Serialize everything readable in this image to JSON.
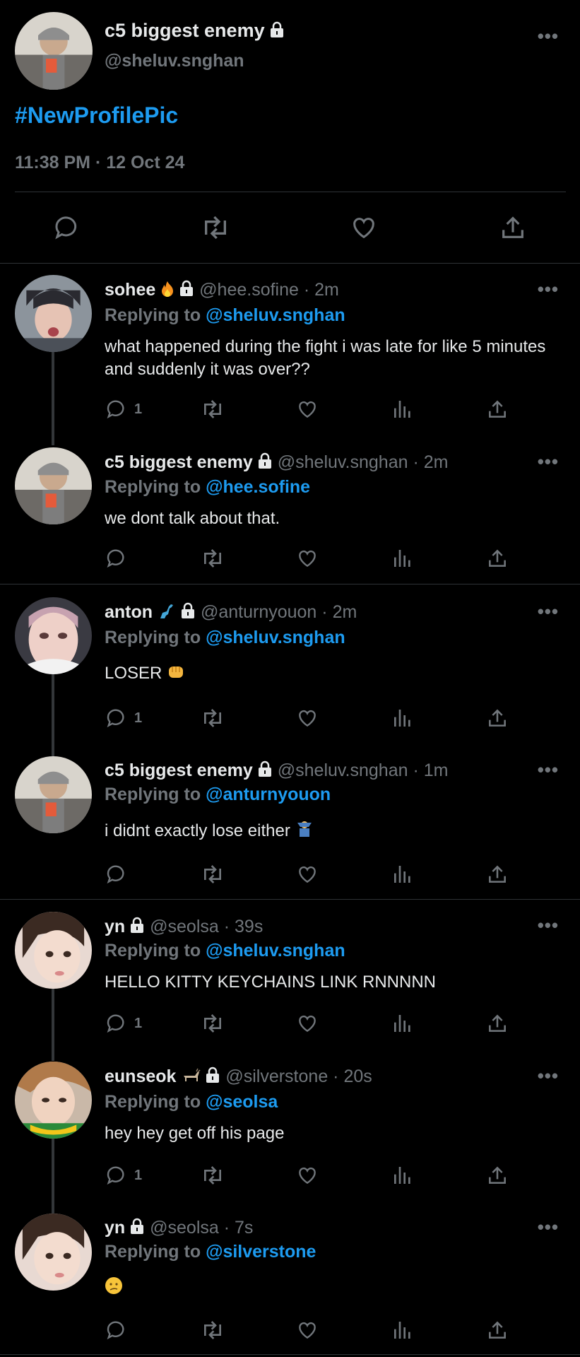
{
  "main_tweet": {
    "name": "c5 biggest enemy",
    "handle": "@sheluv.snghan",
    "text": "#NewProfilePic",
    "timestamp": "11:38 PM · 12 Oct 24",
    "more": "•••"
  },
  "replies": [
    {
      "name": "sohee",
      "emoji": "fire",
      "handle": "@hee.sofine",
      "time": "· 2m",
      "replying_label": "Replying to",
      "replying_to": "@sheluv.snghan",
      "text": "what happened during the fight i was late for like 5 minutes and suddenly it was over??",
      "reply_count": "1"
    },
    {
      "name": "c5 biggest enemy",
      "handle": "@sheluv.snghan",
      "time": "· 2m",
      "replying_label": "Replying to",
      "replying_to": "@hee.sofine",
      "text": "we dont talk about that.",
      "reply_count": ""
    },
    {
      "name": "anton",
      "emoji": "dinosaur",
      "handle": "@anturnyouon",
      "time": "· 2m",
      "replying_label": "Replying to",
      "replying_to": "@sheluv.snghan",
      "text": "LOSER",
      "text_emoji": "fist",
      "reply_count": "1"
    },
    {
      "name": "c5 biggest enemy",
      "handle": "@sheluv.snghan",
      "time": "· 1m",
      "replying_label": "Replying to",
      "replying_to": "@anturnyouon",
      "text": "i didnt exactly lose either",
      "text_emoji": "person-shrugging",
      "reply_count": ""
    },
    {
      "name": "yn",
      "handle": "@seolsa",
      "time": "· 39s",
      "replying_label": "Replying to",
      "replying_to": "@sheluv.snghan",
      "text": "HELLO KITTY KEYCHAINS LINK RNNNNN",
      "reply_count": "1"
    },
    {
      "name": "eunseok",
      "emoji": "goat",
      "handle": "@silverstone",
      "time": "· 20s",
      "replying_label": "Replying to",
      "replying_to": "@seolsa",
      "text": "hey hey get off his page",
      "reply_count": "1"
    },
    {
      "name": "yn",
      "handle": "@seolsa",
      "time": "· 7s",
      "replying_label": "Replying to",
      "replying_to": "@silverstone",
      "text": "",
      "text_emoji": "confused-face",
      "reply_count": ""
    }
  ],
  "colors": {
    "background": "#000000",
    "text": "#e7e9ea",
    "muted": "#71767b",
    "accent": "#1d9bf0",
    "divider": "#2f3336"
  },
  "icons": [
    "lock-icon",
    "more-icon",
    "reply-icon",
    "retweet-icon",
    "like-icon",
    "views-icon",
    "share-icon"
  ]
}
